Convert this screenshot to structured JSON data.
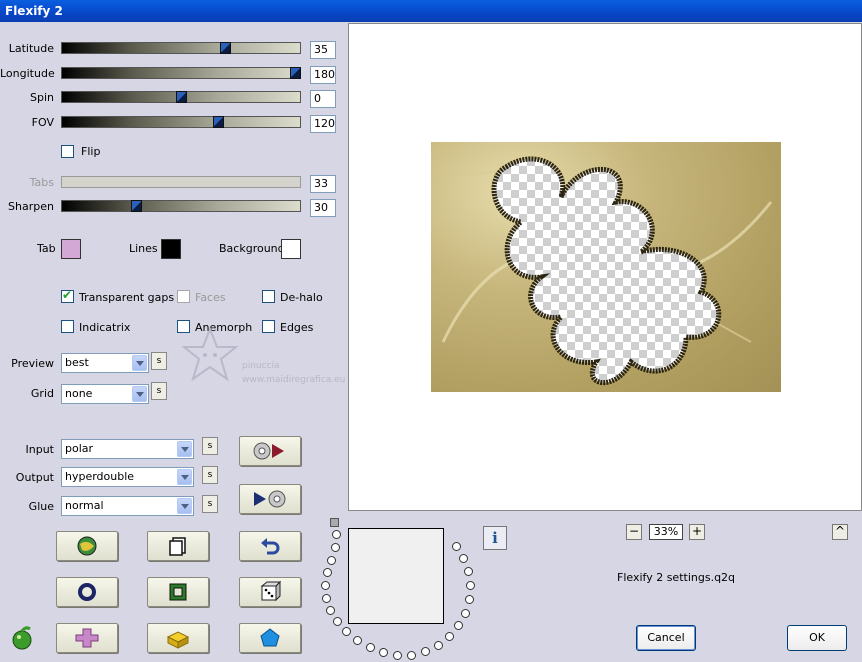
{
  "window": {
    "title": "Flexify 2"
  },
  "sliders": [
    {
      "key": "latitude",
      "label": "Latitude",
      "value": "35",
      "position": 0.7,
      "disabled": false
    },
    {
      "key": "longitude",
      "label": "Longitude",
      "value": "180",
      "position": 1.0,
      "disabled": false
    },
    {
      "key": "spin",
      "label": "Spin",
      "value": "0",
      "position": 0.5,
      "disabled": false
    },
    {
      "key": "fov",
      "label": "FOV",
      "value": "120",
      "position": 0.67,
      "disabled": false
    },
    {
      "key": "tabs",
      "label": "Tabs",
      "value": "33",
      "position": null,
      "disabled": true
    },
    {
      "key": "sharpen",
      "label": "Sharpen",
      "value": "30",
      "position": 0.3,
      "disabled": false
    }
  ],
  "flip": {
    "label": "Flip",
    "checked": false
  },
  "colors": {
    "tab": {
      "label": "Tab",
      "value": "#d4a8d4"
    },
    "lines": {
      "label": "Lines",
      "value": "#000000"
    },
    "background": {
      "label": "Background",
      "value": "#ffffff"
    }
  },
  "options": {
    "transparent_gaps": {
      "label": "Transparent gaps",
      "checked": true
    },
    "faces": {
      "label": "Faces",
      "checked": false,
      "disabled": true
    },
    "de_halo": {
      "label": "De-halo",
      "checked": false
    },
    "indicatrix": {
      "label": "Indicatrix",
      "checked": false
    },
    "anemorph": {
      "label": "Anemorph",
      "checked": false
    },
    "edges": {
      "label": "Edges",
      "checked": false
    }
  },
  "preview_select": {
    "label": "Preview",
    "value": "best"
  },
  "grid_select": {
    "label": "Grid",
    "value": "none"
  },
  "input_select": {
    "label": "Input",
    "value": "polar"
  },
  "output_select": {
    "label": "Output",
    "value": "hyperdouble"
  },
  "glue_select": {
    "label": "Glue",
    "value": "normal"
  },
  "small_button_label": "s",
  "watermark": {
    "line1": "pinuccia",
    "line2": "www.maidiregrafica.eu"
  },
  "zoom": {
    "level": "33%",
    "minus": "−",
    "plus": "+"
  },
  "settings_file": "Flexify 2 settings.q2q",
  "collapse_label": "^",
  "info_label": "i",
  "buttons": {
    "cancel": "Cancel",
    "ok": "OK"
  },
  "accent_colors": {
    "title_bar": "#0746c8",
    "window_bg": "#d6d6e4"
  }
}
